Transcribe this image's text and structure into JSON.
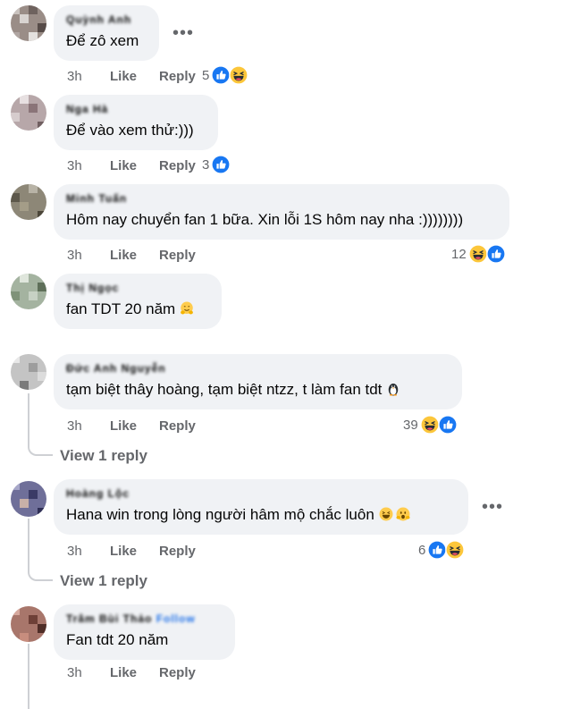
{
  "comments": [
    {
      "author": "Quỳnh Anh",
      "text": "Để zô xem",
      "time": "3h",
      "like": "Like",
      "reply": "Reply",
      "reaction_count": "5",
      "reactions": [
        "like-reaction-icon",
        "haha-reaction-icon"
      ]
    },
    {
      "author": "Nga Hà",
      "text": "Để vào xem thử:)))",
      "time": "3h",
      "like": "Like",
      "reply": "Reply",
      "reaction_count": "3",
      "reactions": [
        "like-reaction-icon"
      ]
    },
    {
      "author": "Minh Tuấn",
      "text": "Hôm nay chuyển fan 1 bữa. Xin lỗi 1S hôm nay nha :))))))))",
      "time": "3h",
      "like": "Like",
      "reply": "Reply",
      "reaction_count": "12",
      "reactions": [
        "haha-reaction-icon",
        "like-reaction-icon"
      ]
    },
    {
      "author": "Thị Ngọc",
      "text": "fan TDT 20 năm",
      "time": "",
      "like": "",
      "reply": "",
      "reaction_count": "",
      "reactions": []
    },
    {
      "author": "Đức Anh Nguyễn",
      "text": "tạm biệt thây hoàng, tạm biệt ntzz, t làm fan tdt",
      "time": "3h",
      "like": "Like",
      "reply": "Reply",
      "reaction_count": "39",
      "reactions": [
        "haha-reaction-icon",
        "like-reaction-icon"
      ],
      "view_replies": "View 1 reply"
    },
    {
      "author": "Hoàng Lộc",
      "text": "Hana win trong lòng người hâm mộ chắc luôn",
      "time": "3h",
      "like": "Like",
      "reply": "Reply",
      "reaction_count": "6",
      "reactions": [
        "like-reaction-icon",
        "haha-reaction-icon"
      ],
      "view_replies": "View 1 reply"
    },
    {
      "author": "Trâm Bùi Thảo",
      "author_highlight": "Follow",
      "text": "Fan tdt 20 năm",
      "time": "3h",
      "like": "Like",
      "reply": "Reply",
      "reaction_count": "",
      "reactions": []
    }
  ],
  "colors": {
    "bubble": "#f0f2f5",
    "meta": "#65676b",
    "like_blue": "#1877f2",
    "haha_yellow": "#fcc63a"
  }
}
